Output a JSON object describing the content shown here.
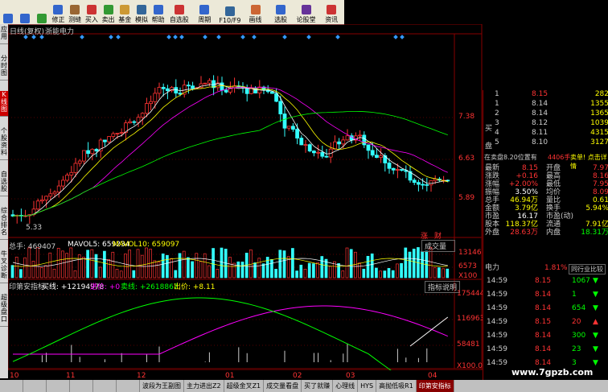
{
  "toolbar": {
    "items": [
      {
        "label": "",
        "icon": "back-icon"
      },
      {
        "label": "",
        "icon": "back-icon"
      },
      {
        "label": "",
        "icon": "refresh-icon"
      },
      {
        "label": "修正",
        "icon": "edit-icon"
      },
      {
        "label": "测缝",
        "icon": "measure-icon"
      },
      {
        "label": "买入",
        "icon": "buy-icon"
      },
      {
        "label": "卖出",
        "icon": "sell-icon"
      },
      {
        "label": "基金",
        "icon": "fund-icon"
      },
      {
        "label": "模拟",
        "icon": "simulate-icon"
      },
      {
        "label": "帮助",
        "icon": "help-icon"
      },
      {
        "label": "自选股",
        "icon": "watchlist-icon"
      },
      {
        "label": "周期",
        "icon": "period-icon"
      },
      {
        "label": "F10/F9",
        "icon": "f10-icon"
      },
      {
        "label": "画线",
        "icon": "draw-icon"
      },
      {
        "label": "选股",
        "icon": "select-icon"
      },
      {
        "label": "论股堂",
        "icon": "forum-icon"
      },
      {
        "label": "资讯",
        "icon": "news-icon"
      }
    ]
  },
  "sidebar": {
    "tabs": [
      "应用",
      "分时图",
      "K线图",
      "个股资料",
      "自选股",
      "综合排名",
      "牛叉诊断",
      "超级盘口"
    ]
  },
  "chart": {
    "title": "日线(复权)",
    "stock_name": "浙能电力",
    "price_axis": [
      "7.38",
      "6.63",
      "5.89"
    ],
    "low_label": "5.33",
    "zhang_label": "涨",
    "cai_label": "财",
    "vol_legend": {
      "total": "总手: 469407",
      "mavol5": "MAVOL5: 659234",
      "mavol10": "MAVOL10: 659097"
    },
    "vol_dropdown": "成交量",
    "vol_axis": [
      "13146",
      "6573",
      "X100"
    ],
    "ind_legend": {
      "name": "印第安指标",
      "buy": "买线: +12194978",
      "in": "进价: +0",
      "sell": "卖线: +2618867",
      "out": "出价: +8.11"
    },
    "ind_button": "指标说明",
    "ind_axis": [
      "175444",
      "116963",
      "58481",
      "X100.0"
    ],
    "date_axis": [
      "10",
      "11",
      "12",
      "01",
      "02",
      "03",
      "04"
    ]
  },
  "quote": {
    "sell_rows": [
      {
        "no": "1",
        "price": "8.15",
        "vol": "282"
      },
      {
        "no": "1",
        "price": "8.14",
        "vol": "1355"
      },
      {
        "no": "2",
        "price": "8.14",
        "vol": "1365"
      },
      {
        "no": "3",
        "price": "8.12",
        "vol": "1039"
      },
      {
        "no": "4",
        "price": "8.11",
        "vol": "4315"
      },
      {
        "no": "5",
        "price": "8.10",
        "vol": "3127"
      }
    ],
    "buy_label": "买",
    "pan_label": "盘",
    "position_text": "在卖盘8.20位置有",
    "position_vol": "4406手",
    "position_link": "卖单! 点击详情",
    "stats": [
      {
        "l1": "最新",
        "v1": "8.15",
        "l2": "开盘",
        "v2": "7.97",
        "c1": "#f33",
        "c2": "#f33"
      },
      {
        "l1": "涨跌",
        "v1": "+0.16",
        "l2": "最高",
        "v2": "8.16",
        "c1": "#f33",
        "c2": "#f33"
      },
      {
        "l1": "涨幅",
        "v1": "+2.00%",
        "l2": "最低",
        "v2": "7.95",
        "c1": "#f33",
        "c2": "#f33"
      },
      {
        "l1": "振幅",
        "v1": "3.50%",
        "l2": "均价",
        "v2": "8.09",
        "c1": "#fff",
        "c2": "#f33"
      },
      {
        "l1": "总手",
        "v1": "46.94万",
        "l2": "量比",
        "v2": "0.61",
        "c1": "#ff0",
        "c2": "#ff0"
      },
      {
        "l1": "金额",
        "v1": "3.79亿",
        "l2": "换手",
        "v2": "5.94%",
        "c1": "#ff0",
        "c2": "#ff0"
      },
      {
        "l1": "市盈",
        "v1": "16.17",
        "l2": "市盈(动)",
        "v2": "",
        "c1": "#fff",
        "c2": "#fff"
      },
      {
        "l1": "股本",
        "v1": "118.37亿",
        "l2": "流通",
        "v2": "7.91亿",
        "c1": "#ff0",
        "c2": "#ff0"
      },
      {
        "l1": "外盘",
        "v1": "28.63万",
        "l2": "内盘",
        "v2": "18.31万",
        "c1": "#f33",
        "c2": "#0f0"
      }
    ],
    "sector": "电力",
    "sector_pct": "1.81%",
    "peer_button": "同行业比较",
    "ticks": [
      {
        "t": "14:59",
        "p": "8.15",
        "v": "1067",
        "d": "down"
      },
      {
        "t": "14:59",
        "p": "8.14",
        "v": "1",
        "d": "down"
      },
      {
        "t": "14:59",
        "p": "8.14",
        "v": "654",
        "d": "down"
      },
      {
        "t": "14:59",
        "p": "8.15",
        "v": "20",
        "d": "up"
      },
      {
        "t": "14:59",
        "p": "8.14",
        "v": "300",
        "d": "down"
      },
      {
        "t": "14:59",
        "p": "8.14",
        "v": "23",
        "d": "down"
      },
      {
        "t": "14:59",
        "p": "8.14",
        "v": "3",
        "d": "down"
      }
    ]
  },
  "bottom_tabs": [
    "",
    "",
    "",
    "",
    "",
    "",
    "波段为王副图",
    "主力进出Z2",
    "超级金叉Z1",
    "成交量看盘",
    "买了就赚",
    "心理线",
    "HYS",
    "高抛低吸R1",
    "印第安指标"
  ],
  "watermark": "www.7gpzb.com"
}
